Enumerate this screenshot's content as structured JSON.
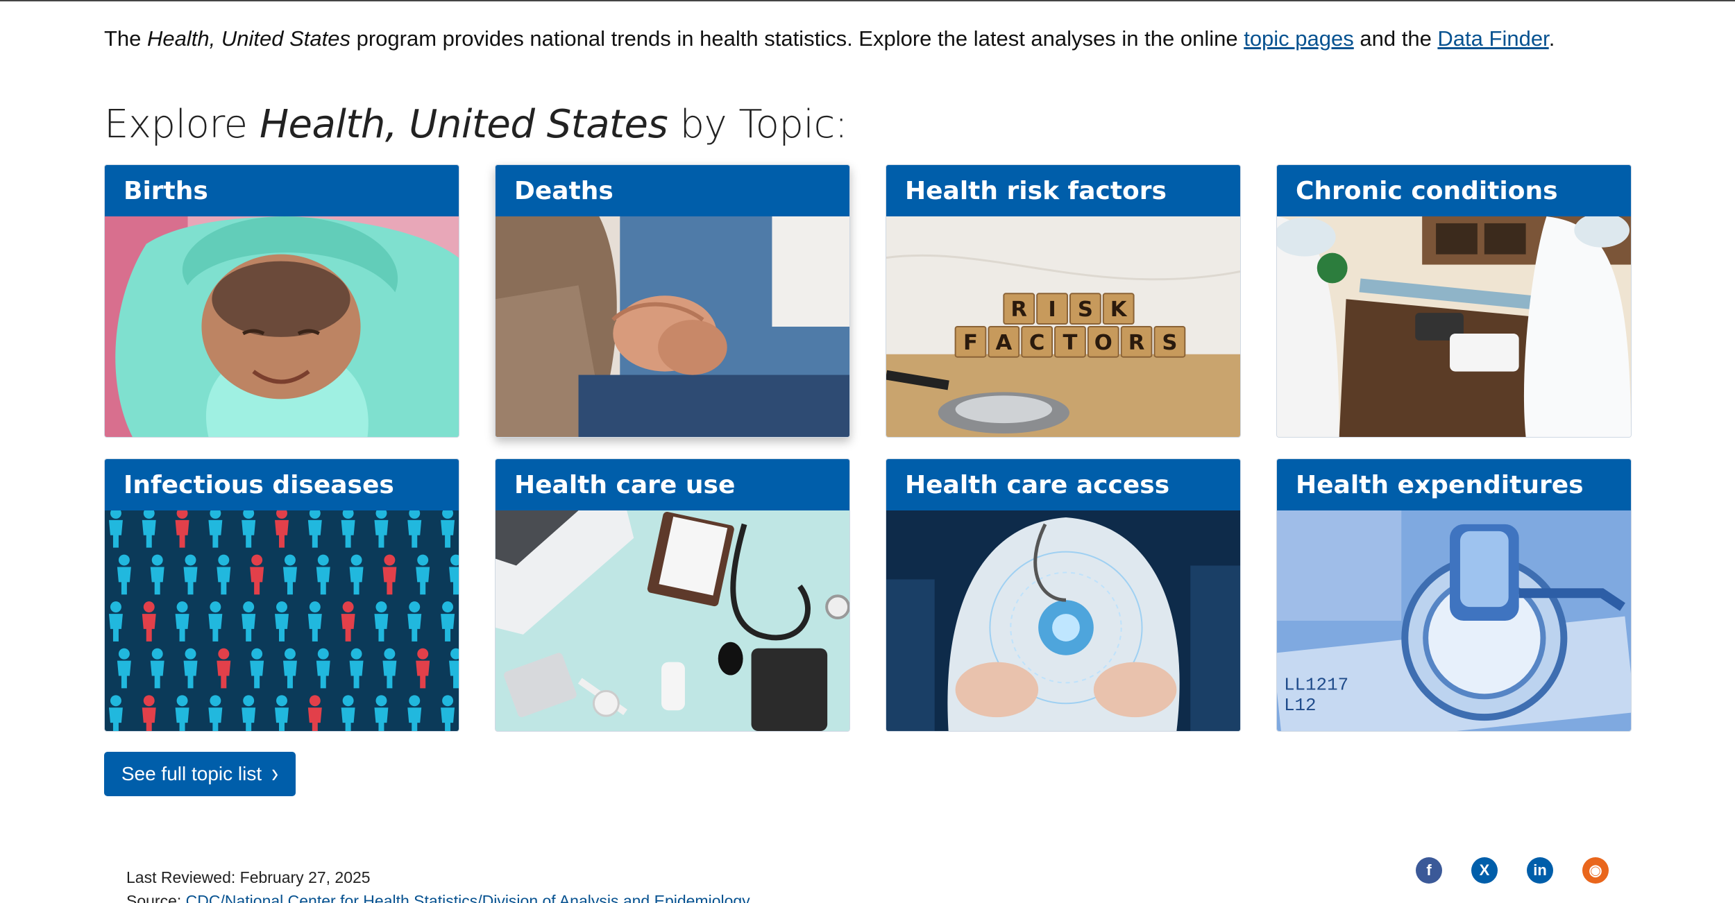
{
  "intro": {
    "prefix": "The ",
    "italic": "Health, United States",
    "middle": " program provides national trends in health statistics. Explore the latest analyses in the online ",
    "link1": "topic pages",
    "between": " and the ",
    "link2": "Data Finder",
    "suffix": "."
  },
  "heading": {
    "prefix": "Explore ",
    "italic": "Health, United States",
    "suffix": " by Topic:"
  },
  "topics": [
    {
      "label": "Births",
      "image": "newborn-baby-photo"
    },
    {
      "label": "Deaths",
      "image": "holding-hands-photo"
    },
    {
      "label": "Health risk factors",
      "image": "risk-factors-blocks-photo"
    },
    {
      "label": "Chronic conditions",
      "image": "blood-pressure-check-photo"
    },
    {
      "label": "Infectious diseases",
      "image": "people-figures-photo"
    },
    {
      "label": "Health care use",
      "image": "medical-desk-photo"
    },
    {
      "label": "Health care access",
      "image": "digital-health-hands-photo"
    },
    {
      "label": "Health expenditures",
      "image": "stethoscope-money-photo"
    }
  ],
  "risk_blocks": {
    "row1": [
      "R",
      "I",
      "S",
      "K"
    ],
    "row2": [
      "F",
      "A",
      "C",
      "T",
      "O",
      "R",
      "S"
    ]
  },
  "bill_text": {
    "serial": "LL1217",
    "number": "L12"
  },
  "button": {
    "label": "See full topic list",
    "icon": "chevron-right-icon"
  },
  "meta": {
    "reviewed": "Last Reviewed: February 27, 2025",
    "source_label": "Source: ",
    "source_link": "CDC/National Center for Health Statistics/Division of Analysis and Epidemiology"
  },
  "social": [
    {
      "name": "facebook",
      "glyph": "f",
      "color": "#3b5998"
    },
    {
      "name": "x",
      "glyph": "X",
      "color": "#005eaa"
    },
    {
      "name": "linkedin",
      "glyph": "in",
      "color": "#005eaa"
    },
    {
      "name": "syndication",
      "glyph": "◉",
      "color": "#e9661c"
    }
  ]
}
